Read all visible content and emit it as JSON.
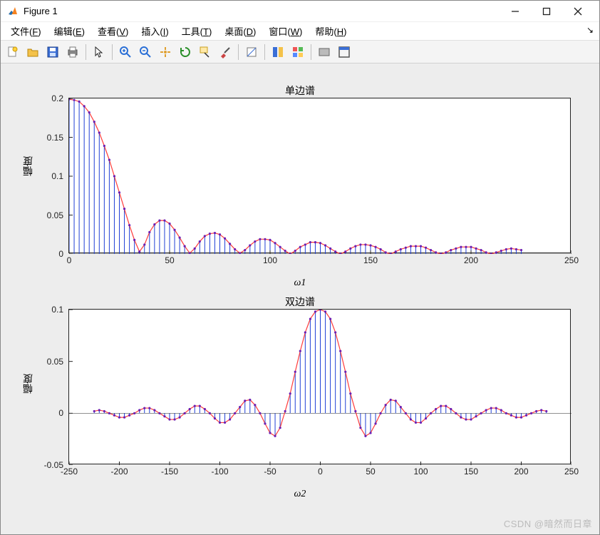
{
  "window": {
    "title": "Figure 1"
  },
  "menu": {
    "items": [
      {
        "label": "文件",
        "key": "F"
      },
      {
        "label": "编辑",
        "key": "E"
      },
      {
        "label": "查看",
        "key": "V"
      },
      {
        "label": "插入",
        "key": "I"
      },
      {
        "label": "工具",
        "key": "T"
      },
      {
        "label": "桌面",
        "key": "D"
      },
      {
        "label": "窗口",
        "key": "W"
      },
      {
        "label": "帮助",
        "key": "H"
      }
    ]
  },
  "toolbar": {
    "icons": [
      "new-figure-icon",
      "open-icon",
      "save-icon",
      "print-icon",
      "sep",
      "pointer-icon",
      "sep",
      "zoom-in-icon",
      "zoom-out-icon",
      "pan-icon",
      "rotate-icon",
      "data-cursor-icon",
      "brush-icon",
      "sep",
      "colorbar-icon",
      "sep",
      "legend-icon",
      "plot-tools-icon",
      "sep",
      "link-plots-icon",
      "dock-icon"
    ]
  },
  "watermark": "CSDN @暗然而日章",
  "chart_data": [
    {
      "type": "stem-line",
      "title": "单边谱",
      "xlabel": "ω1",
      "ylabel": "幅度",
      "xlim": [
        0,
        250
      ],
      "ylim": [
        0,
        0.2
      ],
      "xticks": [
        0,
        50,
        100,
        150,
        200,
        250
      ],
      "yticks": [
        0,
        0.05,
        0.1,
        0.15,
        0.2
      ],
      "line_color": "#ff3b3b",
      "stem_color": "#1f3fd6",
      "marker_color": "#6a1fb3",
      "series": {
        "x_range": [
          0,
          225
        ],
        "step": 2.5,
        "function": "abs(sinc(x/15)) * 0.2 (approx)"
      },
      "values": [
        [
          0,
          0.199
        ],
        [
          2.5,
          0.198
        ],
        [
          5,
          0.196
        ],
        [
          7.5,
          0.19
        ],
        [
          10,
          0.182
        ],
        [
          12.5,
          0.17
        ],
        [
          15,
          0.156
        ],
        [
          17.5,
          0.139
        ],
        [
          20,
          0.121
        ],
        [
          22.5,
          0.1
        ],
        [
          25,
          0.079
        ],
        [
          27.5,
          0.058
        ],
        [
          30,
          0.037
        ],
        [
          32.5,
          0.018
        ],
        [
          35,
          0.003
        ],
        [
          37.5,
          0.012
        ],
        [
          40,
          0.028
        ],
        [
          42.5,
          0.038
        ],
        [
          45,
          0.043
        ],
        [
          47.5,
          0.043
        ],
        [
          50,
          0.039
        ],
        [
          52.5,
          0.031
        ],
        [
          55,
          0.021
        ],
        [
          57.5,
          0.01
        ],
        [
          60,
          0.001
        ],
        [
          62.5,
          0.007
        ],
        [
          65,
          0.016
        ],
        [
          67.5,
          0.023
        ],
        [
          70,
          0.026
        ],
        [
          72.5,
          0.027
        ],
        [
          75,
          0.025
        ],
        [
          77.5,
          0.02
        ],
        [
          80,
          0.013
        ],
        [
          82.5,
          0.006
        ],
        [
          85,
          0.001
        ],
        [
          87.5,
          0.005
        ],
        [
          90,
          0.011
        ],
        [
          92.5,
          0.016
        ],
        [
          95,
          0.019
        ],
        [
          97.5,
          0.019
        ],
        [
          100,
          0.018
        ],
        [
          102.5,
          0.014
        ],
        [
          105,
          0.009
        ],
        [
          107.5,
          0.004
        ],
        [
          110,
          0.0
        ],
        [
          112.5,
          0.004
        ],
        [
          115,
          0.009
        ],
        [
          117.5,
          0.012
        ],
        [
          120,
          0.015
        ],
        [
          122.5,
          0.015
        ],
        [
          125,
          0.014
        ],
        [
          127.5,
          0.011
        ],
        [
          130,
          0.007
        ],
        [
          132.5,
          0.003
        ],
        [
          135,
          0.0
        ],
        [
          137.5,
          0.003
        ],
        [
          140,
          0.007
        ],
        [
          142.5,
          0.01
        ],
        [
          145,
          0.012
        ],
        [
          147.5,
          0.012
        ],
        [
          150,
          0.011
        ],
        [
          152.5,
          0.009
        ],
        [
          155,
          0.006
        ],
        [
          157.5,
          0.002
        ],
        [
          160,
          0.0
        ],
        [
          162.5,
          0.003
        ],
        [
          165,
          0.006
        ],
        [
          167.5,
          0.008
        ],
        [
          170,
          0.01
        ],
        [
          172.5,
          0.01
        ],
        [
          175,
          0.01
        ],
        [
          177.5,
          0.008
        ],
        [
          180,
          0.005
        ],
        [
          182.5,
          0.002
        ],
        [
          185,
          0.0
        ],
        [
          187.5,
          0.002
        ],
        [
          190,
          0.005
        ],
        [
          192.5,
          0.007
        ],
        [
          195,
          0.009
        ],
        [
          197.5,
          0.009
        ],
        [
          200,
          0.009
        ],
        [
          202.5,
          0.007
        ],
        [
          205,
          0.005
        ],
        [
          207.5,
          0.002
        ],
        [
          210,
          0.0
        ],
        [
          212.5,
          0.002
        ],
        [
          215,
          0.004
        ],
        [
          217.5,
          0.006
        ],
        [
          220,
          0.007
        ],
        [
          222.5,
          0.006
        ],
        [
          225,
          0.005
        ]
      ]
    },
    {
      "type": "stem-line",
      "title": "双边谱",
      "xlabel": "ω2",
      "ylabel": "幅度",
      "xlim": [
        -250,
        250
      ],
      "ylim": [
        -0.05,
        0.1
      ],
      "xticks": [
        -250,
        -200,
        -150,
        -100,
        -50,
        0,
        50,
        100,
        150,
        200,
        250
      ],
      "yticks": [
        -0.05,
        0,
        0.05,
        0.1
      ],
      "line_color": "#ff3b3b",
      "stem_color": "#1f3fd6",
      "marker_color": "#6a1fb3",
      "series": {
        "x_range": [
          -225,
          225
        ],
        "step": 5,
        "function": "sinc(x/15) * 0.1 (approx)"
      },
      "values": [
        [
          -225,
          0.002
        ],
        [
          -220,
          0.003
        ],
        [
          -215,
          0.002
        ],
        [
          -210,
          0.0
        ],
        [
          -205,
          -0.002
        ],
        [
          -200,
          -0.004
        ],
        [
          -195,
          -0.004
        ],
        [
          -190,
          -0.002
        ],
        [
          -185,
          0.0
        ],
        [
          -180,
          0.003
        ],
        [
          -175,
          0.005
        ],
        [
          -170,
          0.005
        ],
        [
          -165,
          0.003
        ],
        [
          -160,
          0.0
        ],
        [
          -155,
          -0.003
        ],
        [
          -150,
          -0.006
        ],
        [
          -145,
          -0.006
        ],
        [
          -140,
          -0.004
        ],
        [
          -135,
          0.0
        ],
        [
          -130,
          0.004
        ],
        [
          -125,
          0.007
        ],
        [
          -120,
          0.007
        ],
        [
          -115,
          0.004
        ],
        [
          -110,
          0.0
        ],
        [
          -105,
          -0.005
        ],
        [
          -100,
          -0.009
        ],
        [
          -95,
          -0.009
        ],
        [
          -90,
          -0.006
        ],
        [
          -85,
          0.0
        ],
        [
          -80,
          0.006
        ],
        [
          -75,
          0.012
        ],
        [
          -70,
          0.013
        ],
        [
          -65,
          0.008
        ],
        [
          -60,
          0.0
        ],
        [
          -55,
          -0.01
        ],
        [
          -50,
          -0.019
        ],
        [
          -45,
          -0.022
        ],
        [
          -40,
          -0.014
        ],
        [
          -35,
          0.002
        ],
        [
          -30,
          0.019
        ],
        [
          -25,
          0.04
        ],
        [
          -20,
          0.06
        ],
        [
          -15,
          0.078
        ],
        [
          -10,
          0.091
        ],
        [
          -5,
          0.098
        ],
        [
          0,
          0.1
        ],
        [
          5,
          0.098
        ],
        [
          10,
          0.091
        ],
        [
          15,
          0.078
        ],
        [
          20,
          0.06
        ],
        [
          25,
          0.04
        ],
        [
          30,
          0.019
        ],
        [
          35,
          0.002
        ],
        [
          40,
          -0.014
        ],
        [
          45,
          -0.022
        ],
        [
          50,
          -0.019
        ],
        [
          55,
          -0.01
        ],
        [
          60,
          0.0
        ],
        [
          65,
          0.008
        ],
        [
          70,
          0.013
        ],
        [
          75,
          0.012
        ],
        [
          80,
          0.006
        ],
        [
          85,
          0.0
        ],
        [
          90,
          -0.006
        ],
        [
          95,
          -0.009
        ],
        [
          100,
          -0.009
        ],
        [
          105,
          -0.005
        ],
        [
          110,
          0.0
        ],
        [
          115,
          0.004
        ],
        [
          120,
          0.007
        ],
        [
          125,
          0.007
        ],
        [
          130,
          0.004
        ],
        [
          135,
          0.0
        ],
        [
          140,
          -0.004
        ],
        [
          145,
          -0.006
        ],
        [
          150,
          -0.006
        ],
        [
          155,
          -0.003
        ],
        [
          160,
          0.0
        ],
        [
          165,
          0.003
        ],
        [
          170,
          0.005
        ],
        [
          175,
          0.005
        ],
        [
          180,
          0.003
        ],
        [
          185,
          0.0
        ],
        [
          190,
          -0.002
        ],
        [
          195,
          -0.004
        ],
        [
          200,
          -0.004
        ],
        [
          205,
          -0.002
        ],
        [
          210,
          0.0
        ],
        [
          215,
          0.002
        ],
        [
          220,
          0.003
        ],
        [
          225,
          0.002
        ]
      ]
    }
  ]
}
